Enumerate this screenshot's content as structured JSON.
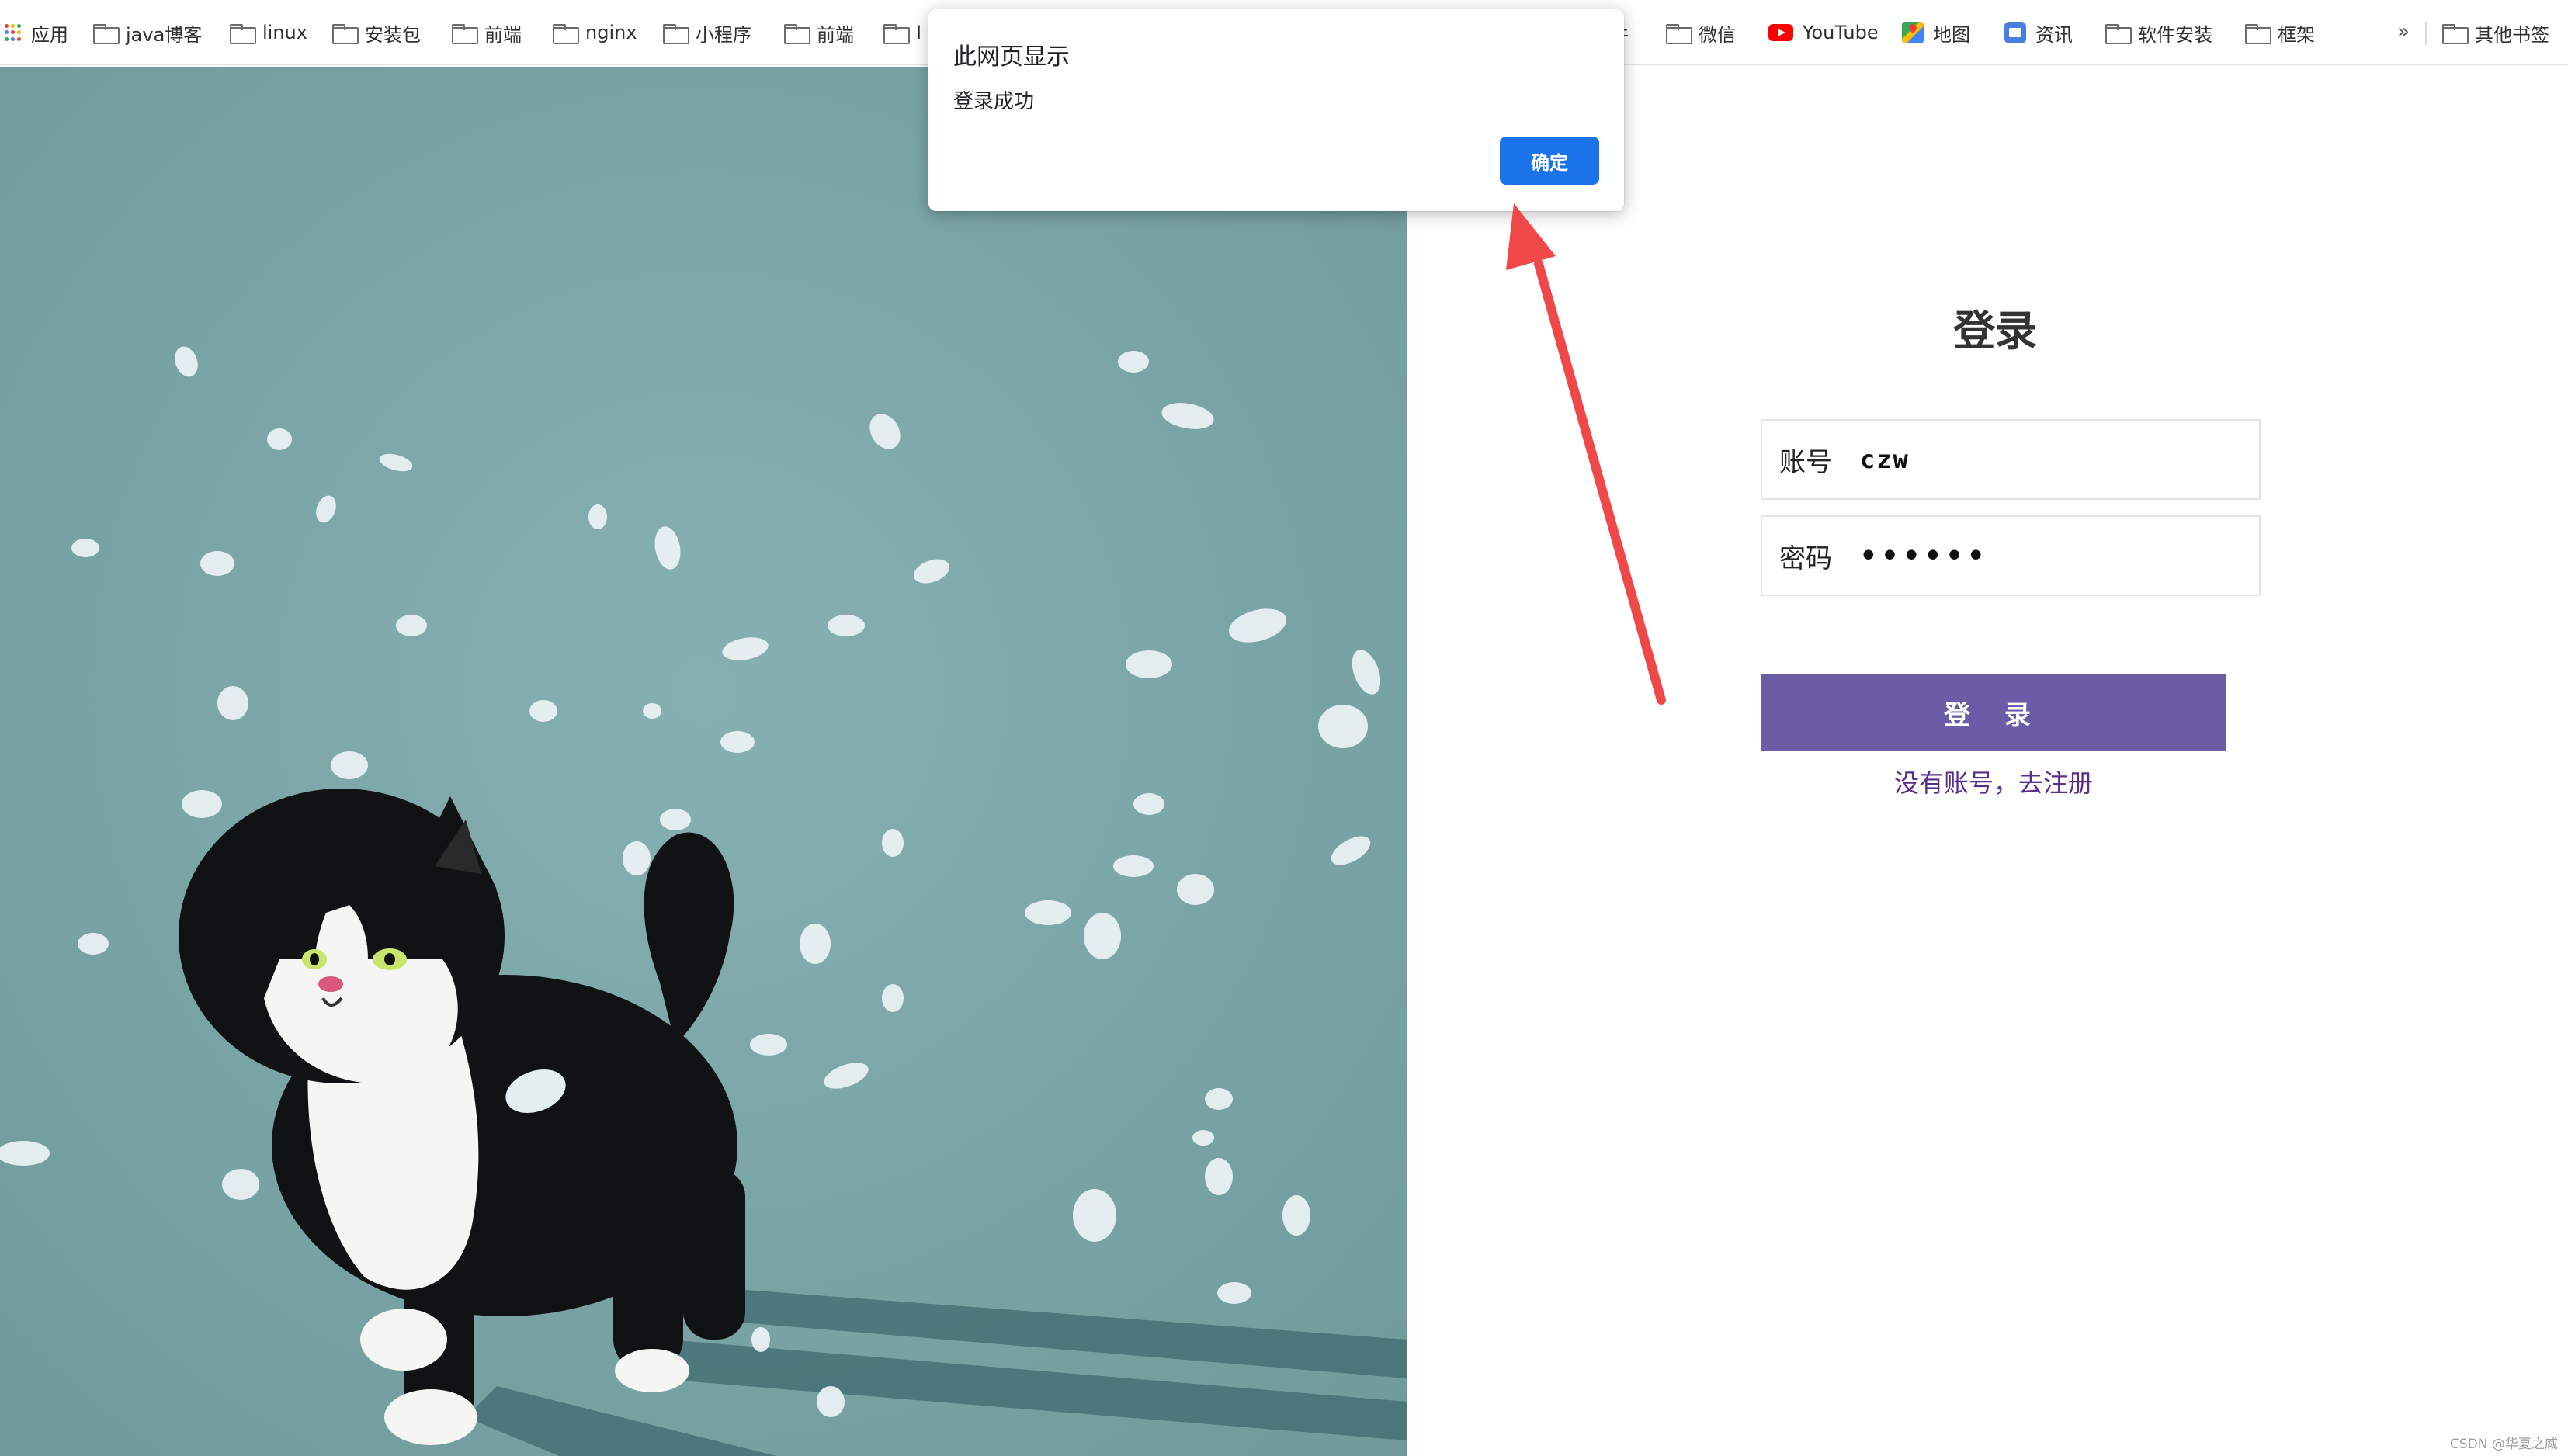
{
  "bookmarks_bar": {
    "items": [
      {
        "label": "应用",
        "icon": "apps-grid-icon"
      },
      {
        "label": "java博客",
        "icon": "folder-icon"
      },
      {
        "label": "linux",
        "icon": "folder-icon"
      },
      {
        "label": "安装包",
        "icon": "folder-icon"
      },
      {
        "label": "前端",
        "icon": "folder-icon"
      },
      {
        "label": "nginx",
        "icon": "folder-icon"
      },
      {
        "label": "小程序",
        "icon": "folder-icon"
      },
      {
        "label": "前端",
        "icon": "folder-icon"
      },
      {
        "label": "I",
        "icon": "folder-icon"
      },
      {
        "label": "件",
        "icon": ""
      },
      {
        "label": "微信",
        "icon": "folder-icon"
      },
      {
        "label": "YouTube",
        "icon": "youtube-icon"
      },
      {
        "label": "地图",
        "icon": "maps-icon"
      },
      {
        "label": "资讯",
        "icon": "news-icon"
      },
      {
        "label": "软件安装",
        "icon": "folder-icon"
      },
      {
        "label": "框架",
        "icon": "folder-icon"
      }
    ],
    "overflow": "»",
    "other_bookmarks": "其他书签"
  },
  "login": {
    "title": "登录",
    "account_label": "账号",
    "account_value": "czw",
    "password_label": "密码",
    "password_value": "••••••",
    "submit_label": "登 录",
    "register_link": "没有账号，去注册"
  },
  "alert": {
    "title": "此网页显示",
    "message": "登录成功",
    "ok_label": "确定"
  },
  "watermark": "CSDN @华夏之威",
  "colors": {
    "accent": "#6b5ca8",
    "dialog_button": "#1a73e8",
    "link": "#5a2d8c",
    "illustration_bg": "#7fa9ab",
    "annotation_arrow": "#f04848"
  }
}
